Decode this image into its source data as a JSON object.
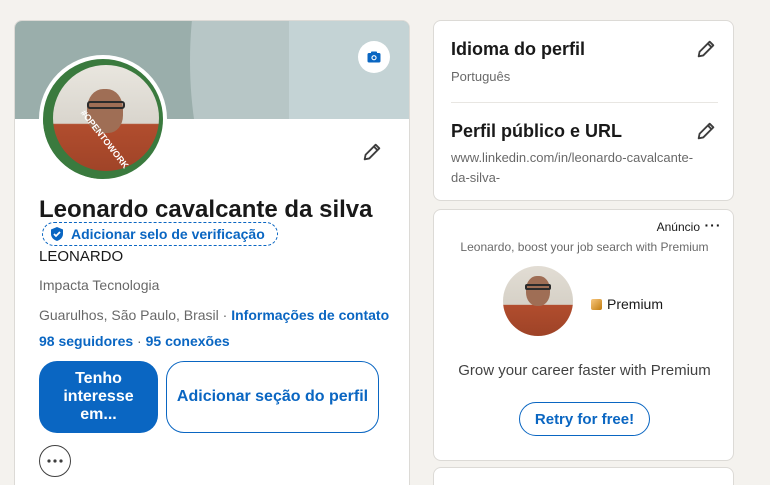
{
  "profile": {
    "name": "Leonardo cavalcante da silva",
    "verification_label": "Adicionar selo de verificação",
    "headline": "LEONARDO",
    "company": "Impacta Tecnologia",
    "location": "Guarulhos, São Paulo, Brasil",
    "separator": " · ",
    "contact_link": "Informações de contato",
    "followers": "98 seguidores",
    "connections_sep": " · ",
    "connections": "95 conexões",
    "open_to_work_frame": "#OPENTOWORK",
    "primary_button": "Tenho interesse em...",
    "add_section_button": "Adicionar seção do perfil"
  },
  "sidebar_settings": {
    "language_title": "Idioma do perfil",
    "language_value": "Português",
    "public_title": "Perfil público e URL",
    "public_value": "www.linkedin.com/in/leonardo-cavalcante-da-silva-"
  },
  "ad": {
    "label": "Anúncio",
    "more": "···",
    "tagline": "Leonardo, boost your job search with Premium",
    "premium_label": "Premium",
    "headline": "Grow your career faster with Premium",
    "cta": "Retry for free!"
  },
  "colors": {
    "brand_blue": "#0a66c2",
    "open_to_work_green": "#3a7a3e",
    "premium_gold": "#c27c0e"
  }
}
